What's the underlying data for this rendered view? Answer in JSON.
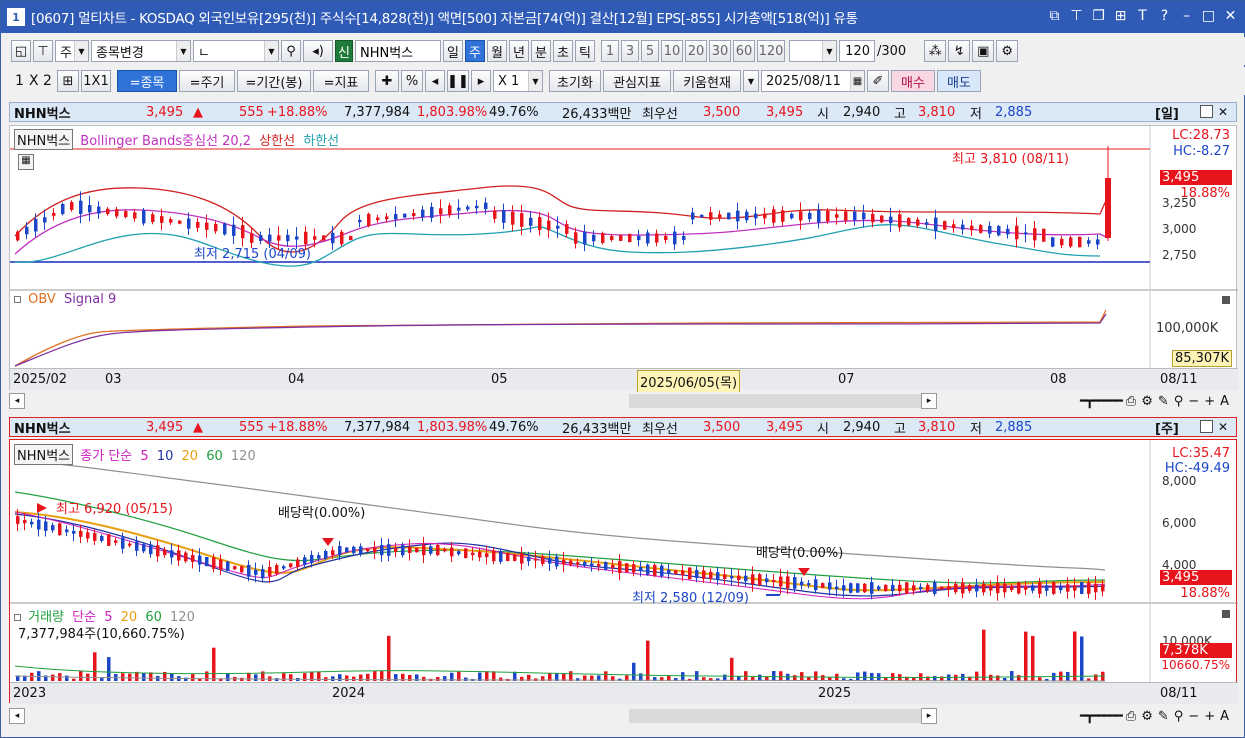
{
  "titlebar": {
    "num": "1",
    "title": "[0607] 멀티차트 - KOSDAQ 외국인보유[295(천)] 주식수[14,828(천)] 액면[500] 자본금[74(억)] 결산[12월] EPS[-855] 시가총액[518(억)] 유통"
  },
  "toolbar1": {
    "type": "주",
    "search_label": "종목변경",
    "input_value": "ㄴ",
    "stock_badge": "신",
    "stock_name": "NHN벅스",
    "periods": [
      "일",
      "주",
      "월",
      "년",
      "분",
      "초",
      "틱"
    ],
    "minutes": [
      "1",
      "3",
      "5",
      "10",
      "20",
      "30",
      "60",
      "120"
    ],
    "count": "120",
    "total": "/300"
  },
  "toolbar2": {
    "layouts": [
      "1",
      "X",
      "2"
    ],
    "grid": "1X1",
    "modes": [
      "=종목",
      "=주기",
      "=기간(봉)",
      "=지표"
    ],
    "pct": "%",
    "mult": "X 1",
    "init": "초기화",
    "interest": "관심지표",
    "kiwoom": "키움현재",
    "date": "2025/08/11",
    "buy": "매수",
    "sell": "매도"
  },
  "info1": {
    "name": "NHN벅스",
    "price": "3,495",
    "arrow": "▲",
    "change": "555",
    "rate": "+18.88%",
    "volume": "7,377,984",
    "vol_rate": "1,803.98%",
    "turnover": "49.76%",
    "amount": "26,433백만",
    "best_label": "최우선",
    "ask": "3,500",
    "bid": "3,495",
    "open_label": "시",
    "open": "2,940",
    "high_label": "고",
    "high": "3,810",
    "low_label": "저",
    "low": "2,885",
    "period": "[일]"
  },
  "chart1": {
    "legend_name": "NHN벅스",
    "legend_bb": "Bollinger Bands중심선 20,2",
    "legend_upper": "상한선",
    "legend_lower": "하한선",
    "lc": "LC:28.73",
    "hc": "HC:-8.27",
    "high_note": "최고 3,810 (08/11)",
    "low_note": "최저 2,715 (04/09)",
    "price_tag": "3,495",
    "pct_tag": "18.88%",
    "yticks": [
      "3,250",
      "3,000",
      "2,750"
    ],
    "obv_label": "OBV",
    "signal_label": "Signal 9",
    "obv_tick": "100,000K",
    "obv_tag": "85,307K",
    "xlabels": [
      "2025/02",
      "03",
      "04",
      "05",
      "2025/06/05(목)",
      "07",
      "08"
    ],
    "xlast": "08/11"
  },
  "info2": {
    "name": "NHN벅스",
    "price": "3,495",
    "arrow": "▲",
    "change": "555",
    "rate": "+18.88%",
    "volume": "7,377,984",
    "vol_rate": "1,803.98%",
    "turnover": "49.76%",
    "amount": "26,433백만",
    "best_label": "최우선",
    "ask": "3,500",
    "bid": "3,495",
    "open_label": "시",
    "open": "2,940",
    "high_label": "고",
    "high": "3,810",
    "low_label": "저",
    "low": "2,885",
    "period": "[주]"
  },
  "chart2": {
    "legend_name": "NHN벅스",
    "legend_ma": "종가 단순",
    "ma": [
      "5",
      "10",
      "20",
      "60",
      "120"
    ],
    "lc": "LC:35.47",
    "hc": "HC:-49.49",
    "high_note": "최고 6,920 (05/15)",
    "low_note": "최저 2,580 (12/09)",
    "div1": "배당락(0.00%)",
    "div2": "배당락(0.00%)",
    "yticks": [
      "8,000",
      "6,000",
      "4,000"
    ],
    "price_tag": "3,495",
    "pct_tag": "18.88%",
    "vol_label": "거래량",
    "vol_ma_label": "단순",
    "vol_ma": [
      "5",
      "20",
      "60",
      "120"
    ],
    "vol_value": "7,377,984주(10,660.75%)",
    "vol_tick": "10,000K",
    "vol_tag": "7,378K",
    "vol_pct_tag": "10660.75%",
    "xlabels": [
      "2023",
      "2024",
      "2025"
    ],
    "xlast": "08/11"
  },
  "colors": {
    "up": "#e8141c",
    "down": "#1c46c8",
    "bb_mid": "#c030c0",
    "bb_up": "#d02020",
    "bb_low": "#20a0b0",
    "obv": "#e07020",
    "signal": "#8030a0"
  }
}
